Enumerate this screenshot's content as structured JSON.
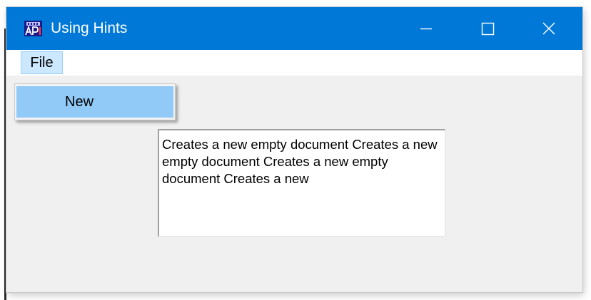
{
  "window": {
    "title": "Using Hints",
    "icon": "api-app-icon",
    "controls": [
      "minimize-icon",
      "maximize-icon",
      "close-icon"
    ]
  },
  "menubar": {
    "items": [
      {
        "label": "File"
      }
    ]
  },
  "file_menu": {
    "items": [
      {
        "label": "New"
      }
    ]
  },
  "hint_box": {
    "text": "Creates a new empty document Creates a new empty document Creates a new empty document Creates a new"
  },
  "colors": {
    "titlebar": "#0078d7",
    "menu_highlight": "#cce8ff",
    "menu_item_hover": "#91c9f7",
    "window_background": "#f0f0f0"
  }
}
